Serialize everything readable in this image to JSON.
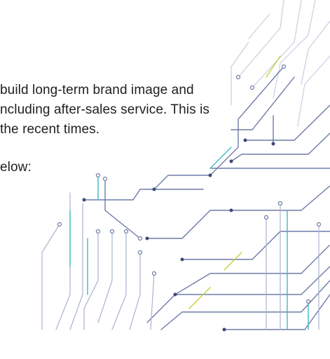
{
  "document": {
    "lines": [
      "build long-term brand image and",
      "ncluding after-sales service. This is",
      "the recent times.",
      "elow:"
    ]
  },
  "decoration": {
    "icon": "circuit-board-graphic",
    "colors": {
      "dark": "#3b4a78",
      "mid": "#6f7ca8",
      "light": "#aab3cf",
      "teal": "#3fb8c9",
      "yellow": "#c9cf3a"
    }
  }
}
